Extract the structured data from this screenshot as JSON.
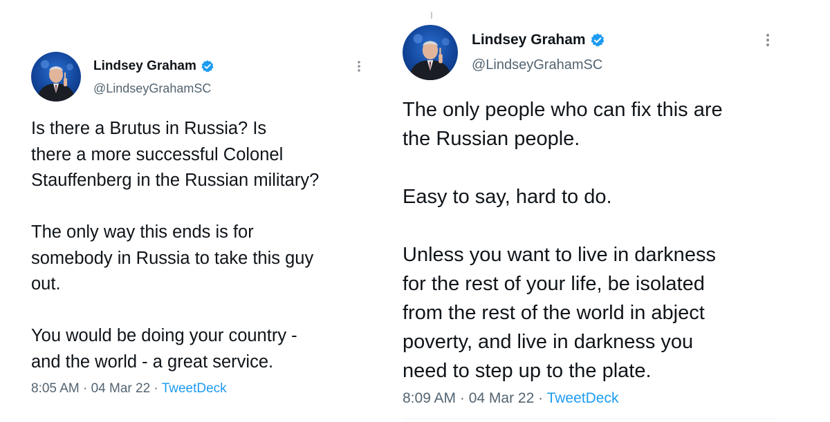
{
  "colors": {
    "verified": "#1d9bf0",
    "source_link": "#1d9bf0",
    "handle": "#536471",
    "text": "#0f1419"
  },
  "tweets": [
    {
      "author": {
        "name": "Lindsey Graham",
        "handle": "@LindseyGrahamSC",
        "verified_icon": "verified-badge-icon",
        "avatar_icon": "profile-photo"
      },
      "more_icon": "more-options-icon",
      "paragraphs": [
        [
          "Is there a Brutus in Russia?  Is",
          "there a more successful Colonel",
          "Stauffenberg in the Russian military?"
        ],
        [
          "The only way this ends is for",
          "somebody in Russia to take this guy",
          "out."
        ],
        [
          "You would be doing your country -",
          "and the world - a great service."
        ]
      ],
      "time": "8:05 AM",
      "date": "04 Mar 22",
      "separator": " · ",
      "source": "TweetDeck"
    },
    {
      "author": {
        "name": "Lindsey Graham",
        "handle": "@LindseyGrahamSC",
        "verified_icon": "verified-badge-icon",
        "avatar_icon": "profile-photo"
      },
      "more_icon": "more-options-icon",
      "paragraphs": [
        [
          "The only people who can fix this are",
          "the Russian people."
        ],
        [
          "Easy to say, hard to do."
        ],
        [
          "Unless you want to live in darkness",
          "for the rest of your life, be isolated",
          "from the rest of the world in abject",
          "poverty, and live in darkness you",
          "need to step up to the plate."
        ]
      ],
      "time": "8:09 AM",
      "date": "04 Mar 22",
      "separator": " · ",
      "source": "TweetDeck"
    }
  ]
}
